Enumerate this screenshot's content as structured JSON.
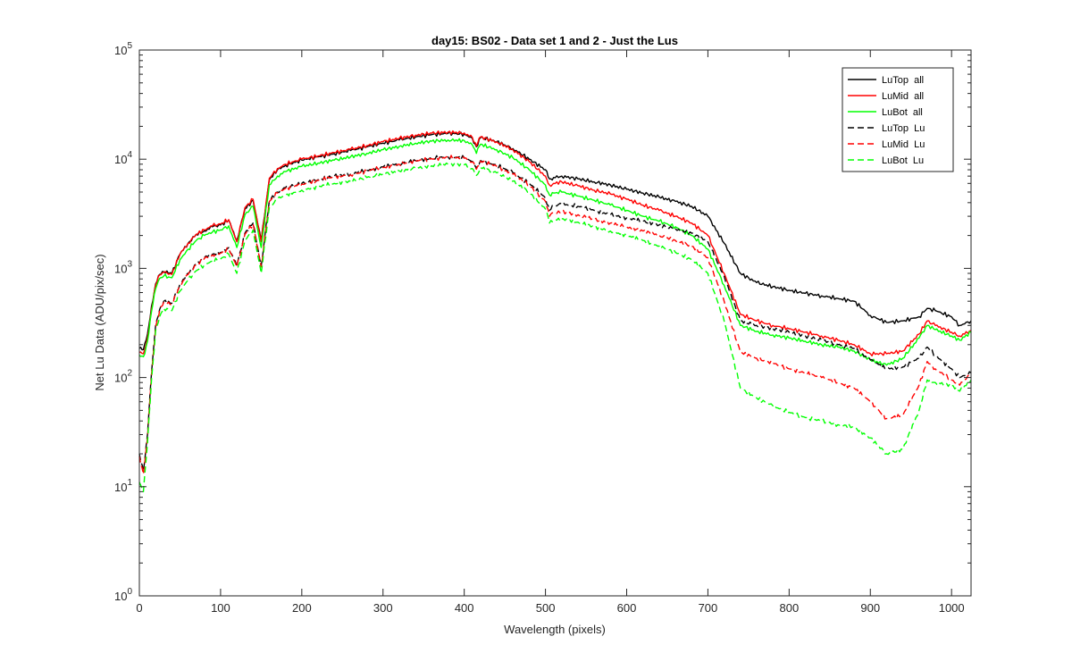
{
  "chart_data": {
    "type": "line",
    "title": "day15: BS02 - Data set 1 and 2 - Just the Lus",
    "xlabel": "Wavelength (pixels)",
    "ylabel": "Net Lu Data (ADU/pix/sec)",
    "xlim": [
      0,
      1024
    ],
    "ylim": [
      1,
      100000
    ],
    "yscale": "log",
    "grid": false,
    "legend_placement": "top-right",
    "x_ticks": [
      {
        "value": 0,
        "label": "0"
      },
      {
        "value": 100,
        "label": "100"
      },
      {
        "value": 200,
        "label": "200"
      },
      {
        "value": 300,
        "label": "300"
      },
      {
        "value": 400,
        "label": "400"
      },
      {
        "value": 500,
        "label": "500"
      },
      {
        "value": 600,
        "label": "600"
      },
      {
        "value": 700,
        "label": "700"
      },
      {
        "value": 800,
        "label": "800"
      },
      {
        "value": 900,
        "label": "900"
      },
      {
        "value": 1000,
        "label": "1000"
      }
    ],
    "y_ticks": [
      {
        "value": 1,
        "base": "10",
        "exp": "0"
      },
      {
        "value": 10,
        "base": "10",
        "exp": "1"
      },
      {
        "value": 100,
        "base": "10",
        "exp": "2"
      },
      {
        "value": 1000,
        "base": "10",
        "exp": "3"
      },
      {
        "value": 10000,
        "base": "10",
        "exp": "4"
      },
      {
        "value": 100000,
        "base": "10",
        "exp": "5"
      }
    ],
    "x": [
      0,
      5,
      10,
      15,
      20,
      25,
      30,
      40,
      50,
      60,
      70,
      80,
      90,
      100,
      110,
      120,
      130,
      140,
      150,
      160,
      170,
      180,
      200,
      220,
      240,
      260,
      280,
      300,
      320,
      340,
      360,
      380,
      400,
      410,
      415,
      420,
      440,
      460,
      480,
      500,
      505,
      510,
      520,
      540,
      560,
      580,
      600,
      620,
      640,
      660,
      680,
      700,
      720,
      740,
      760,
      780,
      800,
      820,
      840,
      860,
      880,
      900,
      920,
      940,
      960,
      970,
      980,
      1000,
      1010,
      1024
    ],
    "series": [
      {
        "name": "LuTop  all",
        "color": "#000000",
        "dash": "solid",
        "values": [
          185,
          180,
          250,
          450,
          720,
          880,
          930,
          900,
          1350,
          1700,
          2050,
          2200,
          2400,
          2500,
          2750,
          1800,
          3500,
          4200,
          1800,
          6500,
          8000,
          8800,
          9800,
          10500,
          11200,
          12000,
          13000,
          14000,
          15000,
          16000,
          16800,
          17200,
          17000,
          15500,
          13000,
          15800,
          14500,
          12500,
          10000,
          8000,
          6600,
          6800,
          7000,
          6600,
          6200,
          5800,
          5300,
          4900,
          4500,
          4100,
          3700,
          3000,
          1700,
          900,
          740,
          680,
          630,
          590,
          560,
          530,
          500,
          370,
          320,
          330,
          360,
          430,
          410,
          360,
          300,
          330
        ]
      },
      {
        "name": "LuMid  all",
        "color": "#ff0000",
        "dash": "solid",
        "values": [
          170,
          165,
          230,
          420,
          700,
          870,
          920,
          880,
          1350,
          1700,
          2050,
          2250,
          2450,
          2550,
          2800,
          1750,
          3600,
          4300,
          1750,
          6700,
          8200,
          9000,
          10000,
          10700,
          11500,
          12300,
          13300,
          14500,
          15500,
          16600,
          17300,
          17700,
          17400,
          15800,
          13200,
          16000,
          14400,
          12200,
          9500,
          7000,
          5800,
          6000,
          6200,
          5700,
          5200,
          4800,
          4300,
          3800,
          3400,
          3000,
          2600,
          2000,
          900,
          380,
          330,
          300,
          280,
          260,
          240,
          220,
          200,
          165,
          165,
          175,
          250,
          330,
          300,
          260,
          240,
          270
        ]
      },
      {
        "name": "LuBot  all",
        "color": "#00ff00",
        "dash": "solid",
        "values": [
          160,
          155,
          215,
          400,
          650,
          810,
          850,
          820,
          1200,
          1500,
          1800,
          2000,
          2150,
          2250,
          2450,
          1550,
          3100,
          3700,
          1550,
          5800,
          7000,
          7700,
          8600,
          9200,
          9800,
          10500,
          11300,
          12200,
          13100,
          14000,
          14600,
          15000,
          14800,
          13500,
          11300,
          13700,
          12200,
          10300,
          8000,
          5800,
          4700,
          4900,
          5000,
          4600,
          4200,
          3800,
          3400,
          3000,
          2700,
          2400,
          2000,
          1500,
          700,
          300,
          265,
          245,
          230,
          215,
          200,
          190,
          175,
          145,
          130,
          150,
          230,
          300,
          275,
          240,
          220,
          260
        ]
      },
      {
        "name": "LuTop  Lu",
        "color": "#000000",
        "dash": "dashed",
        "values": [
          20,
          14,
          30,
          110,
          300,
          420,
          500,
          480,
          720,
          900,
          1100,
          1250,
          1350,
          1400,
          1550,
          1050,
          2100,
          2600,
          1050,
          4200,
          5000,
          5500,
          6000,
          6500,
          7000,
          7300,
          7900,
          8500,
          9100,
          9700,
          10200,
          10500,
          10300,
          9500,
          8200,
          9700,
          8800,
          7500,
          6000,
          4400,
          3400,
          3700,
          3900,
          3700,
          3400,
          3100,
          2900,
          2700,
          2500,
          2300,
          2100,
          1750,
          850,
          330,
          300,
          280,
          260,
          240,
          220,
          200,
          185,
          145,
          120,
          125,
          150,
          190,
          160,
          120,
          100,
          110
        ]
      },
      {
        "name": "LuMid  Lu",
        "color": "#ff0000",
        "dash": "dashed",
        "values": [
          19,
          13,
          28,
          105,
          290,
          410,
          490,
          470,
          700,
          880,
          1080,
          1230,
          1330,
          1380,
          1530,
          1030,
          2050,
          2550,
          1030,
          4100,
          4900,
          5400,
          5900,
          6400,
          6900,
          7200,
          7800,
          8400,
          9000,
          9600,
          10100,
          10400,
          10200,
          9400,
          8100,
          9600,
          8600,
          7300,
          5800,
          4100,
          3000,
          3200,
          3300,
          3100,
          2800,
          2600,
          2400,
          2200,
          2000,
          1800,
          1600,
          1250,
          500,
          170,
          150,
          135,
          120,
          110,
          100,
          90,
          80,
          60,
          42,
          45,
          85,
          140,
          120,
          95,
          85,
          110
        ]
      },
      {
        "name": "LuBot  Lu",
        "color": "#00ff00",
        "dash": "dashed",
        "values": [
          11,
          9,
          25,
          95,
          270,
          360,
          430,
          410,
          620,
          780,
          950,
          1080,
          1170,
          1220,
          1350,
          900,
          1800,
          2250,
          900,
          3600,
          4300,
          4700,
          5200,
          5600,
          6000,
          6300,
          6800,
          7300,
          7800,
          8300,
          8700,
          9000,
          8900,
          8200,
          7100,
          8400,
          7500,
          6300,
          5000,
          3500,
          2600,
          2750,
          2850,
          2650,
          2400,
          2200,
          2000,
          1800,
          1600,
          1400,
          1200,
          900,
          330,
          80,
          65,
          55,
          48,
          43,
          40,
          37,
          35,
          28,
          20,
          22,
          50,
          95,
          90,
          85,
          75,
          95
        ]
      }
    ]
  }
}
